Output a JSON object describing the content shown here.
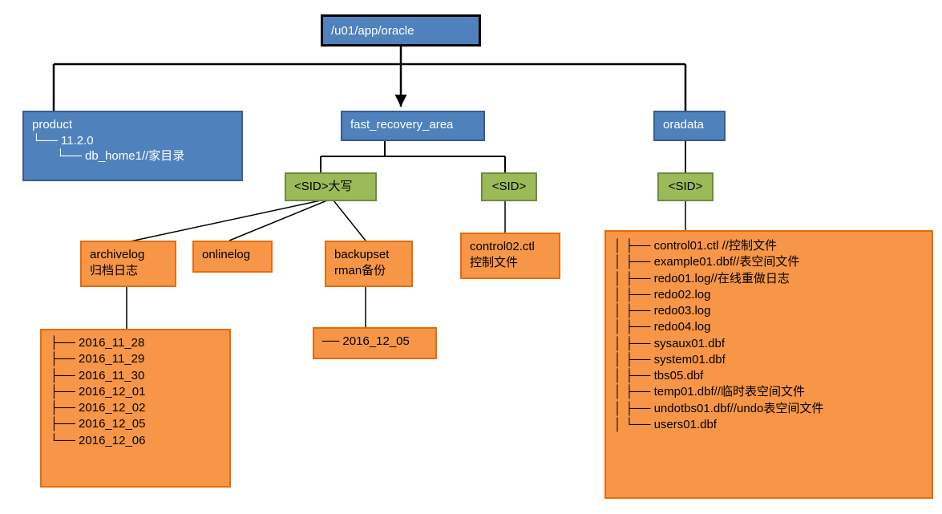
{
  "root": {
    "label": "/u01/app/oracle"
  },
  "product": {
    "title": "product",
    "line1": "└── 11.2.0",
    "line2": "　　└── db_home1//家目录"
  },
  "fast_recovery": {
    "title": "fast_recovery_area"
  },
  "oradata": {
    "title": "oradata"
  },
  "sid_upper": {
    "label": "<SID>大写"
  },
  "sid_fra": {
    "label": "<SID>"
  },
  "sid_oradata": {
    "label": "<SID>"
  },
  "archivelog": {
    "line1": "archivelog",
    "line2": "归档日志"
  },
  "onlinelog": {
    "label": "onlinelog"
  },
  "backupset": {
    "line1": "backupset",
    "line2": " rman备份"
  },
  "control02": {
    "line1": "control02.ctl",
    "line2": "控制文件"
  },
  "archivelog_dates": {
    "items": [
      "├── 2016_11_28",
      "├── 2016_11_29",
      "├── 2016_11_30",
      "├── 2016_12_01",
      "├── 2016_12_02",
      "├── 2016_12_05",
      "└── 2016_12_06"
    ]
  },
  "backupset_dates": {
    "items": [
      "── 2016_12_05"
    ]
  },
  "oradata_files": {
    "items": [
      "│   ├── control01.ctl  //控制文件",
      "│   ├── example01.dbf//表空间文件",
      "│   ├── redo01.log//在线重做日志",
      "│   ├── redo02.log",
      "│   ├── redo03.log",
      "│   ├── redo04.log",
      "│   ├── sysaux01.dbf",
      "│   ├── system01.dbf",
      "│   ├── tbs05.dbf",
      "│   ├── temp01.dbf//临时表空间文件",
      "│   ├── undotbs01.dbf//undo表空间文件",
      "│   └── users01.dbf"
    ]
  }
}
